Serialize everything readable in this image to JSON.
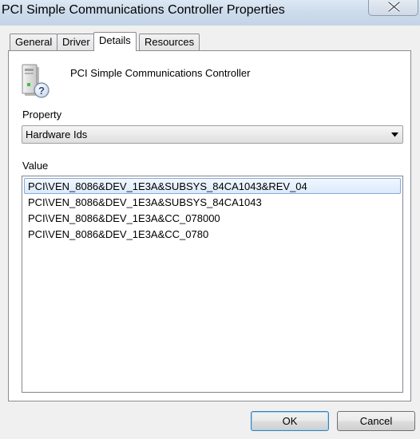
{
  "window": {
    "title": "PCI Simple Communications Controller Properties"
  },
  "tabs": [
    {
      "label": "General",
      "active": false
    },
    {
      "label": "Driver",
      "active": false
    },
    {
      "label": "Details",
      "active": true
    },
    {
      "label": "Resources",
      "active": false
    }
  ],
  "device": {
    "name": "PCI Simple Communications Controller",
    "icon": "unknown-device-icon"
  },
  "property": {
    "label": "Property",
    "selected": "Hardware Ids"
  },
  "value": {
    "label": "Value",
    "items": [
      {
        "text": "PCI\\VEN_8086&DEV_1E3A&SUBSYS_84CA1043&REV_04",
        "selected": true
      },
      {
        "text": "PCI\\VEN_8086&DEV_1E3A&SUBSYS_84CA1043",
        "selected": false
      },
      {
        "text": "PCI\\VEN_8086&DEV_1E3A&CC_078000",
        "selected": false
      },
      {
        "text": "PCI\\VEN_8086&DEV_1E3A&CC_0780",
        "selected": false
      }
    ]
  },
  "buttons": {
    "ok": "OK",
    "cancel": "Cancel"
  }
}
